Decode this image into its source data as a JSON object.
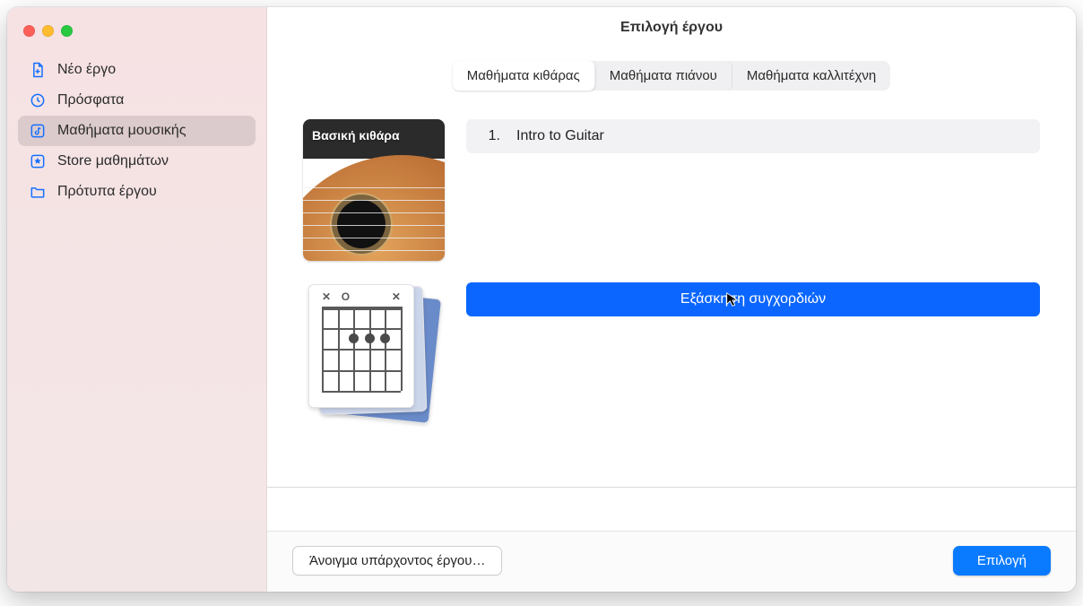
{
  "window": {
    "title": "Επιλογή έργου"
  },
  "sidebar": {
    "items": [
      {
        "label": "Νέο έργο",
        "icon": "document-plus-icon"
      },
      {
        "label": "Πρόσφατα",
        "icon": "clock-icon"
      },
      {
        "label": "Μαθήματα μουσικής",
        "icon": "music-note-icon"
      },
      {
        "label": "Store μαθημάτων",
        "icon": "star-box-icon"
      },
      {
        "label": "Πρότυπα έργου",
        "icon": "folder-icon"
      }
    ]
  },
  "tabs": [
    {
      "label": "Μαθήματα κιθάρας",
      "selected": true
    },
    {
      "label": "Μαθήματα πιάνου",
      "selected": false
    },
    {
      "label": "Μαθήματα καλλιτέχνη",
      "selected": false
    }
  ],
  "groups": [
    {
      "thumb_caption": "Βασική κιθάρα",
      "lessons": [
        {
          "num": "1.",
          "title": "Intro to Guitar",
          "selected": false
        }
      ]
    },
    {
      "thumb_caption": "",
      "lessons": [
        {
          "num": "",
          "title": "Εξάσκηση συγχορδιών",
          "selected": true
        }
      ]
    }
  ],
  "footer": {
    "open_existing": "Άνοιγμα υπάρχοντος έργου…",
    "choose": "Επιλογή"
  },
  "colors": {
    "accent": "#0a7bff",
    "selection": "#0a66ff"
  }
}
